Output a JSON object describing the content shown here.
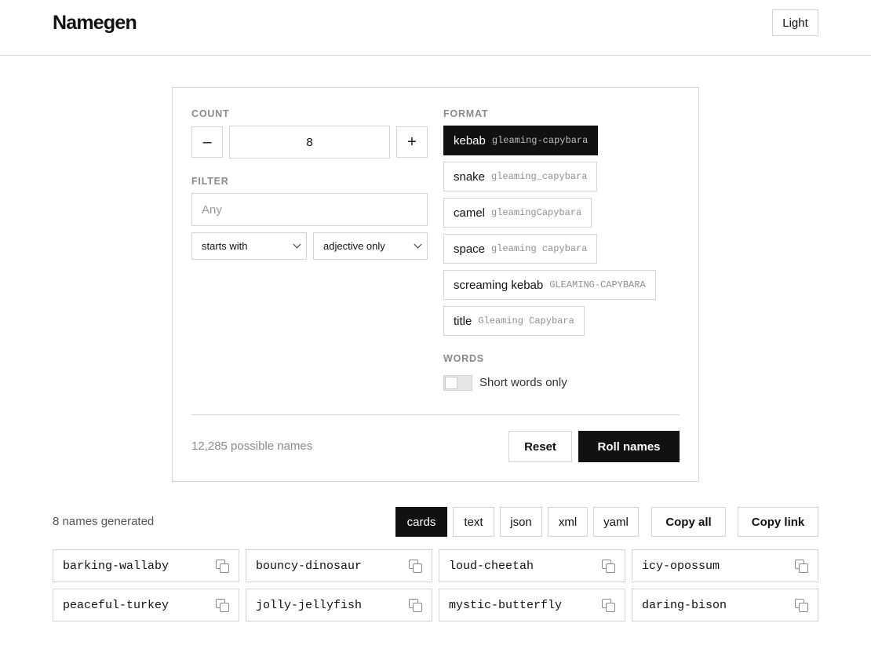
{
  "app": {
    "title": "Namegen",
    "theme_label": "Light"
  },
  "controls": {
    "count": {
      "label": "COUNT",
      "value": "8",
      "decrement": "–",
      "increment": "+"
    },
    "filter": {
      "label": "FILTER",
      "placeholder": "Any",
      "match_mode": "starts with",
      "scope": "adjective only"
    },
    "format": {
      "label": "FORMAT",
      "selected": "kebab",
      "options": [
        {
          "name": "kebab",
          "example": "gleaming-capybara"
        },
        {
          "name": "snake",
          "example": "gleaming_capybara"
        },
        {
          "name": "camel",
          "example": "gleamingCapybara"
        },
        {
          "name": "space",
          "example": "gleaming capybara"
        },
        {
          "name": "screaming kebab",
          "example": "GLEAMING-CAPYBARA"
        },
        {
          "name": "title",
          "example": "Gleaming Capybara"
        }
      ]
    },
    "words": {
      "label": "WORDS",
      "toggle_label": "Short words only",
      "enabled": false
    },
    "possible_names": "12,285 possible names",
    "reset_label": "Reset",
    "roll_label": "Roll names"
  },
  "results": {
    "summary": "8 names generated",
    "view_modes": [
      "cards",
      "text",
      "json",
      "xml",
      "yaml"
    ],
    "active_view": "cards",
    "copy_all_label": "Copy all",
    "copy_link_label": "Copy link",
    "names": [
      "barking-wallaby",
      "bouncy-dinosaur",
      "loud-cheetah",
      "icy-opossum",
      "peaceful-turkey",
      "jolly-jellyfish",
      "mystic-butterfly",
      "daring-bison"
    ],
    "copy_icon": "copy-icon"
  },
  "colors": {
    "accent": "#111111",
    "border": "#d4d4d4",
    "muted": "#8a8a8a"
  }
}
